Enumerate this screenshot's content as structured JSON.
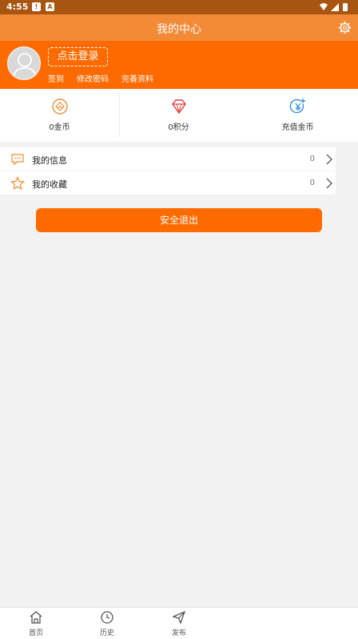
{
  "status_bar": {
    "time": "4:55",
    "icons": [
      "alert-icon",
      "a-icon",
      "wifi-icon",
      "signal-icon",
      "battery-icon"
    ]
  },
  "header": {
    "title": "我的中心",
    "settings_icon": "gear-icon"
  },
  "profile": {
    "login_label": "点击登录",
    "links": [
      "签到",
      "修改密码",
      "完善资料"
    ]
  },
  "stats": [
    {
      "label": "0金币",
      "icon": "coin-icon"
    },
    {
      "label": "0积分",
      "icon": "diamond-icon"
    },
    {
      "label": "充值金币",
      "icon": "recharge-coin-icon"
    }
  ],
  "menu": [
    {
      "label": "我的信息",
      "count": "0",
      "icon": "message-icon"
    },
    {
      "label": "我的收藏",
      "count": "0",
      "icon": "star-icon"
    }
  ],
  "logout_label": "安全退出",
  "tabs": [
    {
      "label": "首页",
      "icon": "home-icon"
    },
    {
      "label": "历史",
      "icon": "clock-icon"
    },
    {
      "label": "发布",
      "icon": "send-icon"
    }
  ],
  "colors": {
    "status_bar": "#a75511",
    "header": "#f38a36",
    "accent": "#fd6b00",
    "background": "#f2f2f2"
  }
}
